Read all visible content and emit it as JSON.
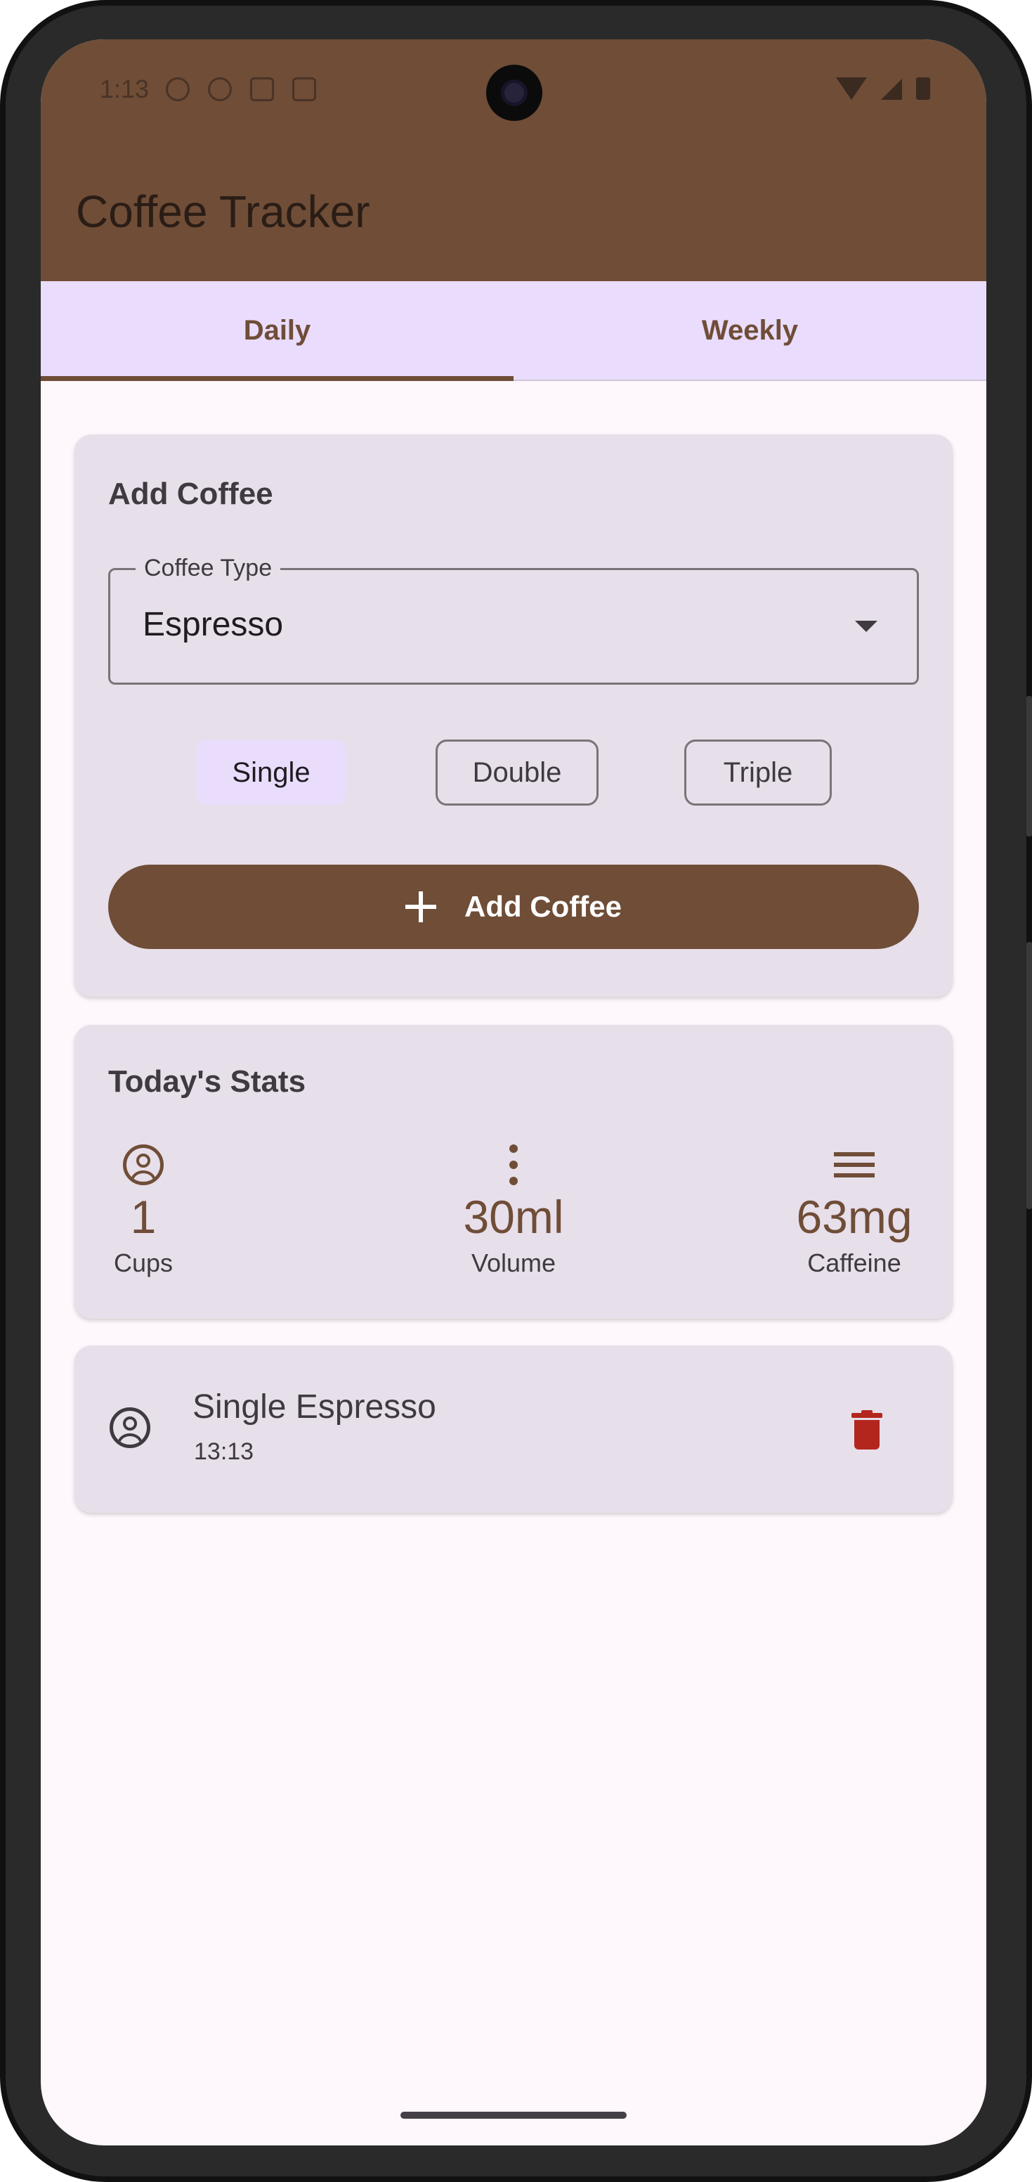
{
  "status_bar": {
    "time": "1:13"
  },
  "app": {
    "title": "Coffee Tracker"
  },
  "tabs": [
    {
      "label": "Daily",
      "selected": true
    },
    {
      "label": "Weekly",
      "selected": false
    }
  ],
  "add_coffee": {
    "title": "Add Coffee",
    "coffee_type": {
      "label": "Coffee Type",
      "value": "Espresso"
    },
    "sizes": [
      {
        "label": "Single",
        "selected": true
      },
      {
        "label": "Double",
        "selected": false
      },
      {
        "label": "Triple",
        "selected": false
      }
    ],
    "add_button_label": "Add Coffee"
  },
  "stats": {
    "title": "Today's Stats",
    "cups": {
      "value": "1",
      "label": "Cups"
    },
    "volume": {
      "value": "30ml",
      "label": "Volume"
    },
    "caffeine": {
      "value": "63mg",
      "label": "Caffeine"
    }
  },
  "entries": [
    {
      "title": "Single Espresso",
      "time": "13:13"
    }
  ],
  "colors": {
    "primary": "#6f4d37",
    "tab_background": "#eadcfd",
    "card_background": "#e7dfea",
    "screen_background": "#fef7fb",
    "delete": "#b3261e"
  }
}
